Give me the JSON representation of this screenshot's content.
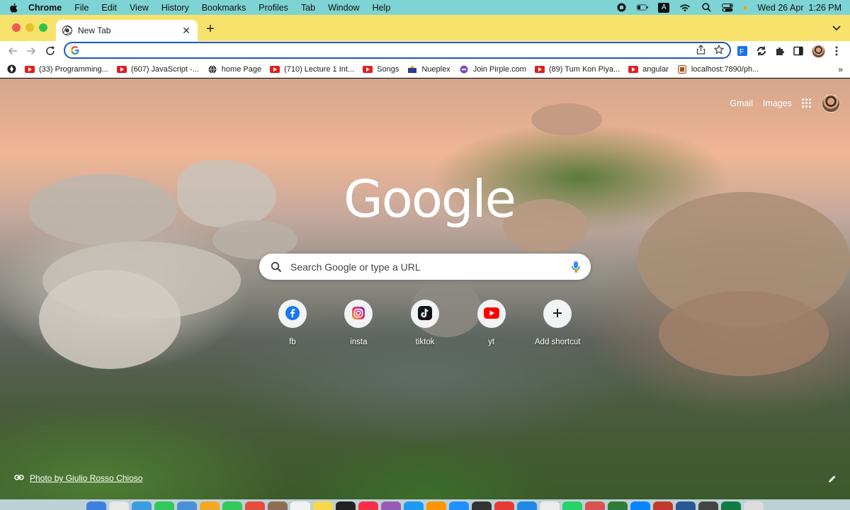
{
  "menubar": {
    "apple_icon": "apple-icon",
    "app_name": "Chrome",
    "items": [
      "File",
      "Edit",
      "View",
      "History",
      "Bookmarks",
      "Profiles",
      "Tab",
      "Window",
      "Help"
    ],
    "datetime": "Wed 26 Apr  1:26 PM",
    "input_source": "A"
  },
  "tab": {
    "title": "New Tab",
    "favicon": "chrome-icon"
  },
  "toolbar": {
    "omnibox_value": ""
  },
  "bookmarks": [
    {
      "label": "(33) Programming...",
      "icon": "youtube-icon"
    },
    {
      "label": "(607) JavaScript -...",
      "icon": "youtube-icon"
    },
    {
      "label": "home Page",
      "icon": "globe-icon"
    },
    {
      "label": "(710) Lecture 1 Int...",
      "icon": "youtube-icon"
    },
    {
      "label": "Songs",
      "icon": "youtube-icon"
    },
    {
      "label": "Nueplex",
      "icon": "nueplex-icon"
    },
    {
      "label": "Join Pirple.com",
      "icon": "pirple-icon"
    },
    {
      "label": "(89) Tum Kon Piya...",
      "icon": "youtube-icon"
    },
    {
      "label": "angular",
      "icon": "youtube-icon"
    },
    {
      "label": "localhost:7890/ph...",
      "icon": "localhost-icon"
    }
  ],
  "bookmarks_more": "»",
  "page": {
    "gmail": "Gmail",
    "images": "Images",
    "logo": "Google",
    "search_placeholder": "Search Google or type a URL",
    "shortcuts": [
      {
        "label": "fb",
        "icon": "facebook-icon"
      },
      {
        "label": "insta",
        "icon": "instagram-icon"
      },
      {
        "label": "tiktok",
        "icon": "tiktok-icon"
      },
      {
        "label": "yt",
        "icon": "youtube-icon"
      },
      {
        "label": "Add shortcut",
        "icon": "plus-icon"
      }
    ],
    "photo_credit": "Photo by Giulio Rosso Chioso"
  },
  "colors": {
    "menubar_bg": "#7ed3d3",
    "tabstrip_bg": "#f7e36b",
    "omnibox_border": "#1a56c4",
    "youtube_red": "#e21e1e"
  }
}
